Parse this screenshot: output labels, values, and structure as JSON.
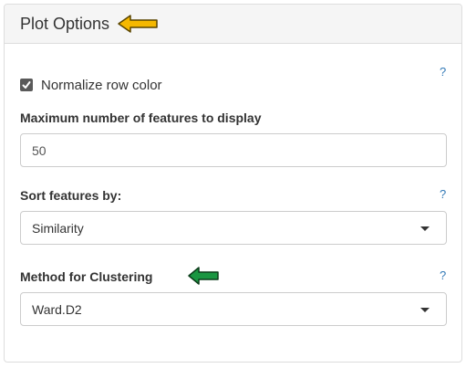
{
  "panel": {
    "title": "Plot Options"
  },
  "normalize": {
    "label": "Normalize row color",
    "checked": true,
    "help": "?"
  },
  "max_features": {
    "label": "Maximum number of features to display",
    "value": "50"
  },
  "sort_by": {
    "label": "Sort features by:",
    "selected": "Similarity",
    "help": "?"
  },
  "clustering": {
    "label": "Method for Clustering",
    "selected": "Ward.D2",
    "help": "?"
  },
  "colors": {
    "title_arrow": "#f5b800",
    "clustering_arrow": "#1a9641",
    "help_link": "#337ab7"
  },
  "icons": {
    "title_arrow": "arrow-left-icon",
    "clustering_arrow": "arrow-left-icon",
    "checkbox": "checkmark-icon",
    "dropdown": "caret-down-icon"
  }
}
